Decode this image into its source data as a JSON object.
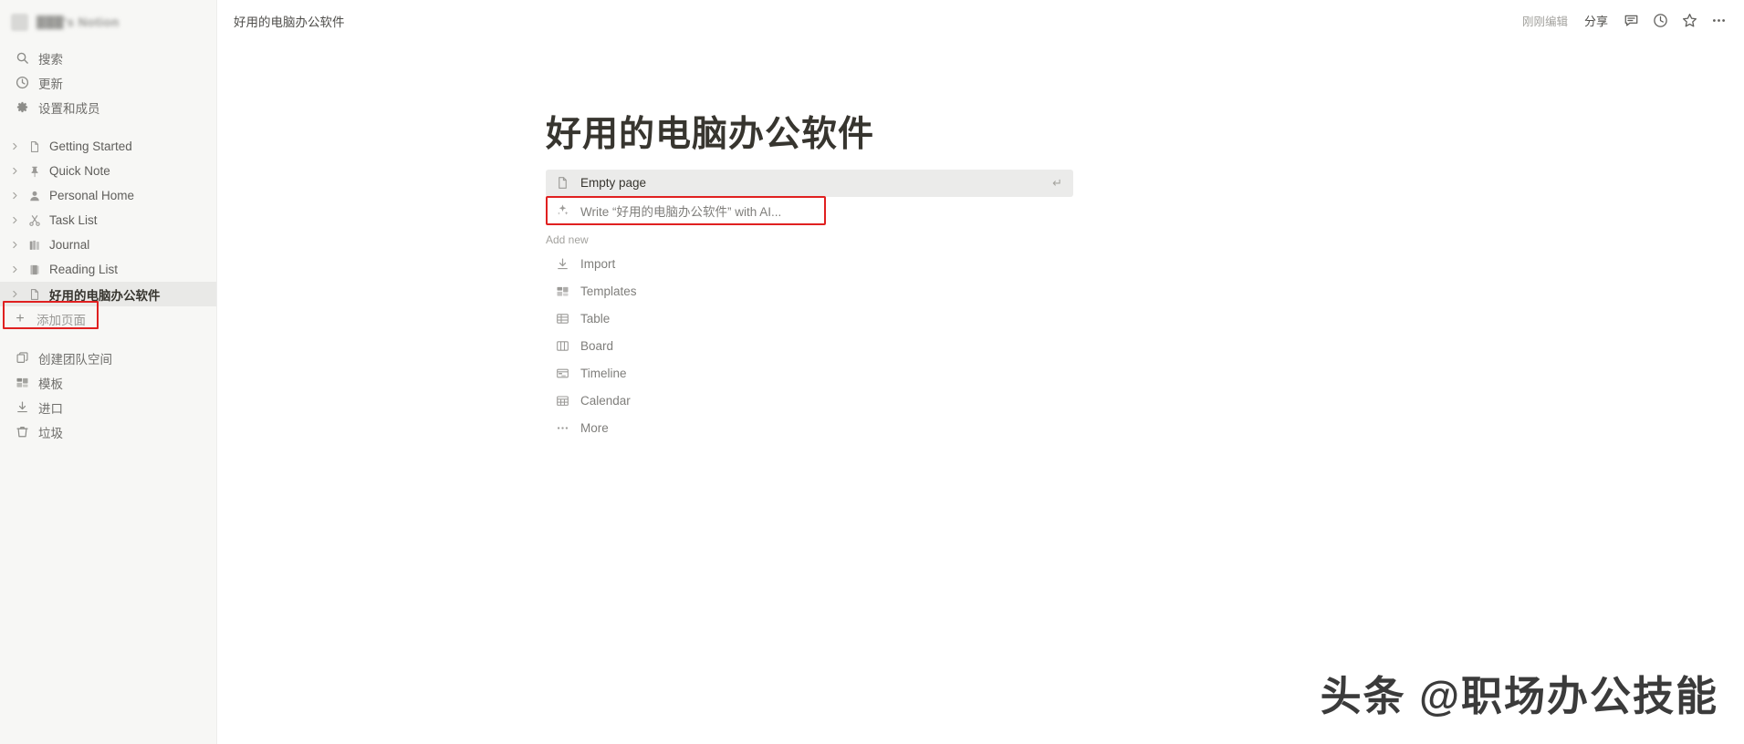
{
  "sidebar": {
    "workspace": {
      "name": "███'s Notion",
      "avatar_icon": "workspace-avatar"
    },
    "quick_actions": [
      {
        "label": "搜索",
        "icon": "search-icon"
      },
      {
        "label": "更新",
        "icon": "clock-updates-icon"
      },
      {
        "label": "设置和成员",
        "icon": "gear-icon"
      }
    ],
    "pages": [
      {
        "label": "Getting Started",
        "icon": "document-icon",
        "selected": false
      },
      {
        "label": "Quick Note",
        "icon": "pushpin-icon",
        "selected": false
      },
      {
        "label": "Personal Home",
        "icon": "person-icon",
        "selected": false
      },
      {
        "label": "Task List",
        "icon": "scissors-icon",
        "selected": false
      },
      {
        "label": "Journal",
        "icon": "books-icon",
        "selected": false
      },
      {
        "label": "Reading List",
        "icon": "notebook-icon",
        "selected": false
      },
      {
        "label": "好用的电脑办公软件",
        "icon": "document-icon",
        "selected": true
      }
    ],
    "add_page": {
      "label": "添加页面",
      "icon": "plus-icon"
    },
    "bottom_actions": [
      {
        "label": "创建团队空间",
        "icon": "teamspace-icon"
      },
      {
        "label": "模板",
        "icon": "templates-icon"
      },
      {
        "label": "进口",
        "icon": "import-icon"
      },
      {
        "label": "垃圾",
        "icon": "trash-icon"
      }
    ]
  },
  "topbar": {
    "breadcrumb": "好用的电脑办公软件",
    "edited_status": "刚刚编辑",
    "share_label": "分享",
    "icons": [
      {
        "name": "comment-icon"
      },
      {
        "name": "history-clock-icon"
      },
      {
        "name": "star-icon"
      },
      {
        "name": "more-options-icon"
      }
    ]
  },
  "page": {
    "title": "好用的电脑办公软件",
    "suggestions": [
      {
        "label": "Empty page",
        "icon": "document-icon",
        "highlighted": true,
        "shortcut": "↵"
      },
      {
        "label": "Write “好用的电脑办公软件” with AI...",
        "icon": "ai-sparkle-icon",
        "highlighted": false,
        "shortcut": ""
      }
    ],
    "add_new_header": "Add new",
    "add_new_items": [
      {
        "label": "Import",
        "icon": "import-icon"
      },
      {
        "label": "Templates",
        "icon": "templates-icon"
      },
      {
        "label": "Table",
        "icon": "table-icon"
      },
      {
        "label": "Board",
        "icon": "board-icon"
      },
      {
        "label": "Timeline",
        "icon": "timeline-icon"
      },
      {
        "label": "Calendar",
        "icon": "calendar-icon"
      },
      {
        "label": "More",
        "icon": "ellipsis-icon"
      }
    ]
  },
  "annotations": {
    "color": "#e02020",
    "boxes": [
      {
        "target": "add-page-button"
      },
      {
        "target": "write-with-ai-row"
      }
    ]
  },
  "watermark": {
    "text": "头条 @职场办公技能"
  }
}
